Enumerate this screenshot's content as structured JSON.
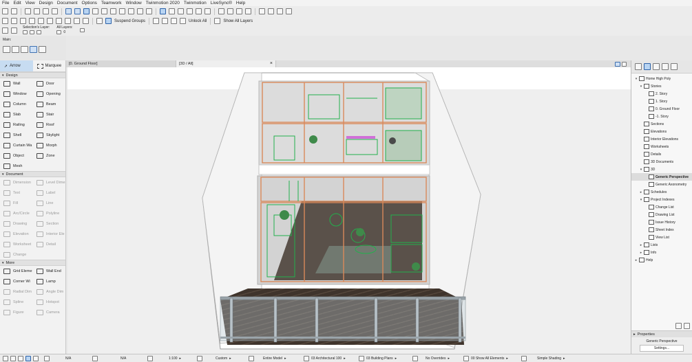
{
  "menu": [
    "File",
    "Edit",
    "View",
    "Design",
    "Document",
    "Options",
    "Teamwork",
    "Window",
    "Twinmotion 2020",
    "Twinmotion",
    "LiveSync®",
    "Help"
  ],
  "toolbar": {
    "suspend_groups": "Suspend Groups",
    "unlock_all": "Unlock All",
    "show_all_layers": "Show All Layers",
    "selection_layer_label": "Selection's Layer:",
    "all_layers_label": "All Layers:",
    "all_layers_count": "0"
  },
  "main_bar": {
    "label": "Main:"
  },
  "toolbox": {
    "arrow": "Arrow",
    "marquee": "Marquee",
    "sections": [
      {
        "title": "Design",
        "tools": [
          {
            "label": "Wall",
            "enabled": true
          },
          {
            "label": "Door",
            "enabled": true
          },
          {
            "label": "Window",
            "enabled": true
          },
          {
            "label": "Opening",
            "enabled": true
          },
          {
            "label": "Column",
            "enabled": true
          },
          {
            "label": "Beam",
            "enabled": true
          },
          {
            "label": "Slab",
            "enabled": true
          },
          {
            "label": "Stair",
            "enabled": true
          },
          {
            "label": "Railing",
            "enabled": true
          },
          {
            "label": "Roof",
            "enabled": true
          },
          {
            "label": "Shell",
            "enabled": true
          },
          {
            "label": "Skylight",
            "enabled": true
          },
          {
            "label": "Curtain Wa",
            "enabled": true
          },
          {
            "label": "Morph",
            "enabled": true
          },
          {
            "label": "Object",
            "enabled": true
          },
          {
            "label": "Zone",
            "enabled": true
          },
          {
            "label": "Mesh",
            "enabled": true
          }
        ]
      },
      {
        "title": "Document",
        "tools": [
          {
            "label": "Dimension",
            "enabled": false
          },
          {
            "label": "Level Dime",
            "enabled": false
          },
          {
            "label": "Text",
            "enabled": false
          },
          {
            "label": "Label",
            "enabled": false
          },
          {
            "label": "Fill",
            "enabled": false
          },
          {
            "label": "Line",
            "enabled": false
          },
          {
            "label": "Arc/Circle",
            "enabled": false
          },
          {
            "label": "Polyline",
            "enabled": false
          },
          {
            "label": "Drawing",
            "enabled": false
          },
          {
            "label": "Section",
            "enabled": false
          },
          {
            "label": "Elevation",
            "enabled": false
          },
          {
            "label": "Interior Ele",
            "enabled": false
          },
          {
            "label": "Worksheet",
            "enabled": false
          },
          {
            "label": "Detail",
            "enabled": false
          },
          {
            "label": "Change",
            "enabled": false
          }
        ]
      },
      {
        "title": "More",
        "tools": [
          {
            "label": "Grid Eleme",
            "enabled": true
          },
          {
            "label": "Wall End",
            "enabled": true
          },
          {
            "label": "Corner Wi",
            "enabled": true
          },
          {
            "label": "Lamp",
            "enabled": true
          },
          {
            "label": "Radial Dim",
            "enabled": false
          },
          {
            "label": "Angle Dim",
            "enabled": false
          },
          {
            "label": "Spline",
            "enabled": false
          },
          {
            "label": "Hotspot",
            "enabled": false
          },
          {
            "label": "Figure",
            "enabled": false
          },
          {
            "label": "Camera",
            "enabled": false
          }
        ]
      }
    ]
  },
  "tabs": [
    {
      "label": "[0. Ground Floor]"
    },
    {
      "label": "[3D / All]",
      "close": "×"
    }
  ],
  "navigator": {
    "tree": [
      {
        "label": "Home High Poly",
        "level": 0,
        "arrow": "v"
      },
      {
        "label": "Stories",
        "level": 1,
        "arrow": "v"
      },
      {
        "label": "2. Story",
        "level": 2,
        "arrow": ""
      },
      {
        "label": "1. Story",
        "level": 2,
        "arrow": ""
      },
      {
        "label": "0. Ground Floor",
        "level": 2,
        "arrow": ""
      },
      {
        "label": "-1. Story",
        "level": 2,
        "arrow": ""
      },
      {
        "label": "Sections",
        "level": 1,
        "arrow": ""
      },
      {
        "label": "Elevations",
        "level": 1,
        "arrow": ""
      },
      {
        "label": "Interior Elevations",
        "level": 1,
        "arrow": ""
      },
      {
        "label": "Worksheets",
        "level": 1,
        "arrow": ""
      },
      {
        "label": "Details",
        "level": 1,
        "arrow": ""
      },
      {
        "label": "3D Documents",
        "level": 1,
        "arrow": ""
      },
      {
        "label": "3D",
        "level": 1,
        "arrow": "v"
      },
      {
        "label": "Generic Perspective",
        "level": 2,
        "arrow": "",
        "selected": true
      },
      {
        "label": "Generic Axonometry",
        "level": 2,
        "arrow": ""
      },
      {
        "label": "Schedules",
        "level": 1,
        "arrow": ">"
      },
      {
        "label": "Project Indexes",
        "level": 1,
        "arrow": "v"
      },
      {
        "label": "Change List",
        "level": 2,
        "arrow": ""
      },
      {
        "label": "Drawing List",
        "level": 2,
        "arrow": ""
      },
      {
        "label": "Issue History",
        "level": 2,
        "arrow": ""
      },
      {
        "label": "Sheet Index",
        "level": 2,
        "arrow": ""
      },
      {
        "label": "View List",
        "level": 2,
        "arrow": ""
      },
      {
        "label": "Lists",
        "level": 1,
        "arrow": ">"
      },
      {
        "label": "Info",
        "level": 1,
        "arrow": ">"
      },
      {
        "label": "Help",
        "level": 0,
        "arrow": ">"
      }
    ],
    "properties_title": "Properties",
    "properties_value": "Generic Perspective",
    "settings_label": "Settings..."
  },
  "status": {
    "na1": "N/A",
    "na2": "N/A",
    "scale": "1:100",
    "pen": "Custom",
    "model": "Entire Model",
    "layer_combo": "03 Architectural 100",
    "view": "03 Building Plans",
    "overrides": "No Overrides",
    "renovation": "00 Show All Elements",
    "shading": "Simple Shading"
  },
  "colors": {
    "accent": "#2b61a8",
    "selection_green": "#22b14c",
    "frame_orange": "#d9895a"
  }
}
